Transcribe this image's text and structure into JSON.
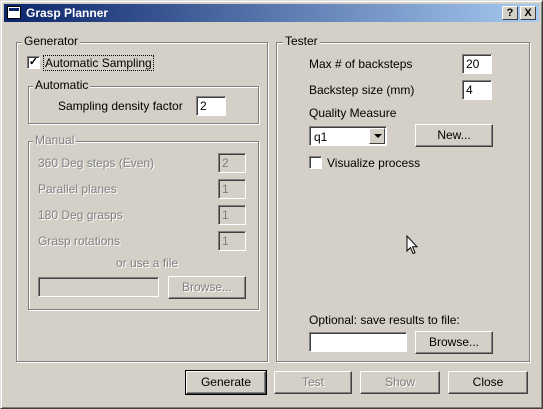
{
  "window": {
    "title": "Grasp Planner",
    "help_label": "?",
    "close_label": "X"
  },
  "generator": {
    "title": "Generator",
    "automatic_sampling": {
      "label": "Automatic Sampling",
      "checked": true
    },
    "automatic": {
      "title": "Automatic",
      "density_label": "Sampling density factor",
      "density_value": "2"
    },
    "manual": {
      "title": "Manual",
      "fields": [
        {
          "label": "360 Deg steps (Even)",
          "value": "2"
        },
        {
          "label": "Parallel planes",
          "value": "1"
        },
        {
          "label": "180 Deg grasps",
          "value": "1"
        },
        {
          "label": "Grasp rotations",
          "value": "1"
        }
      ],
      "file_label": "or use a file",
      "file_value": "",
      "browse_label": "Browse..."
    }
  },
  "tester": {
    "title": "Tester",
    "max_backsteps_label": "Max # of backsteps",
    "max_backsteps_value": "20",
    "backstep_size_label": "Backstep size (mm)",
    "backstep_size_value": "4",
    "quality_measure_label": "Quality Measure",
    "quality_measure_value": "q1",
    "new_label": "New...",
    "visualize_label": "Visualize process",
    "visualize_checked": false,
    "save_label": "Optional: save results to file:",
    "save_value": "",
    "browse_label": "Browse..."
  },
  "footer": {
    "generate_label": "Generate",
    "test_label": "Test",
    "show_label": "Show",
    "close_label": "Close"
  }
}
